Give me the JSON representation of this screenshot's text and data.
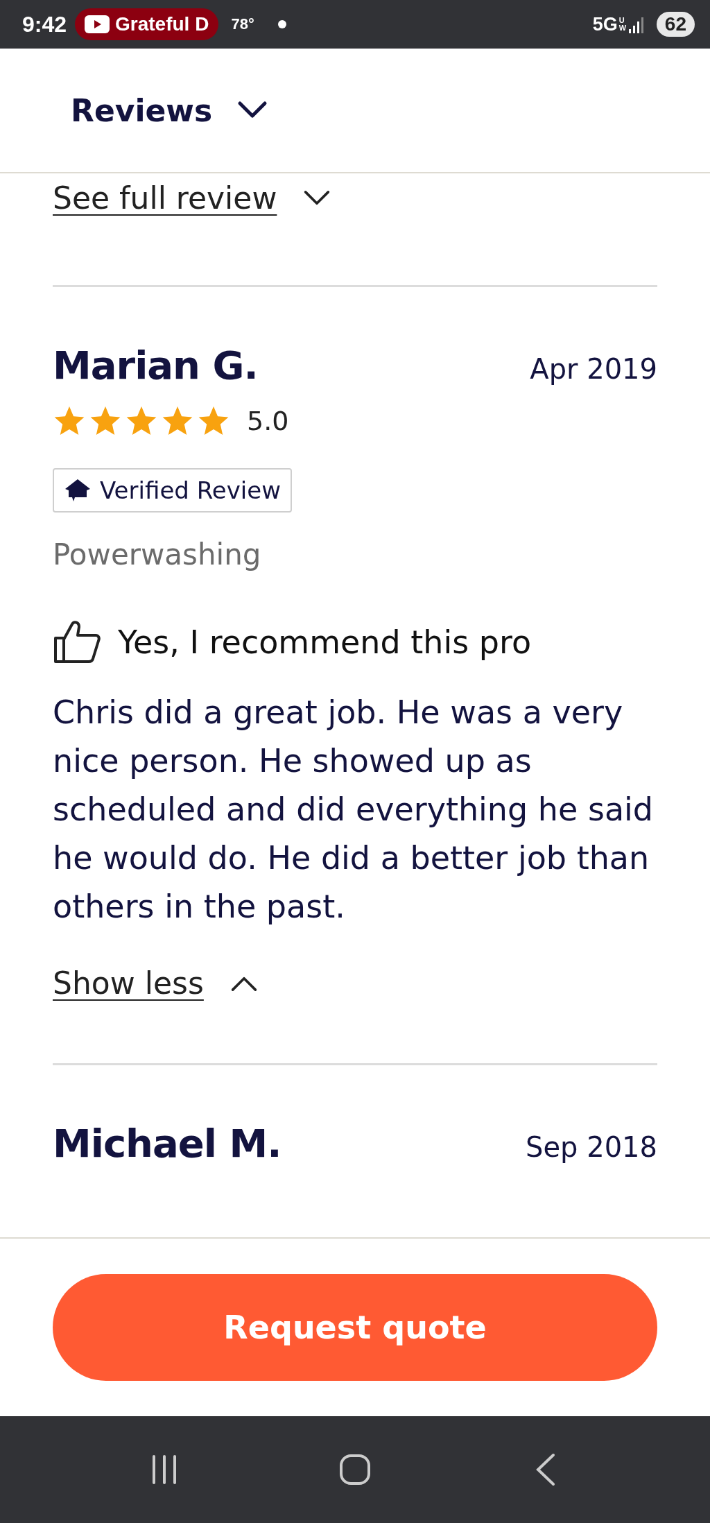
{
  "status_bar": {
    "time": "9:42",
    "notification": "Grateful D",
    "temperature": "78°",
    "network": "5G",
    "network_sub": "UW",
    "battery": "62"
  },
  "header": {
    "title": "Reviews",
    "expanded": false
  },
  "previous_review": {
    "link": "See full review",
    "expanded": false
  },
  "reviews": [
    {
      "name": "Marian G.",
      "date": "Apr 2019",
      "stars": 5,
      "rating": "5.0",
      "badge": "Verified Review",
      "service": "Powerwashing",
      "recommend": "Yes, I recommend this pro",
      "text": "Chris did a great job. He was a very nice person. He showed up as scheduled and did everything he said he would do. He did a better job than others in the past.",
      "toggle": "Show less",
      "expanded": true
    },
    {
      "name": "Michael M.",
      "date": "Sep 2018"
    }
  ],
  "footer": {
    "button": "Request quote"
  }
}
